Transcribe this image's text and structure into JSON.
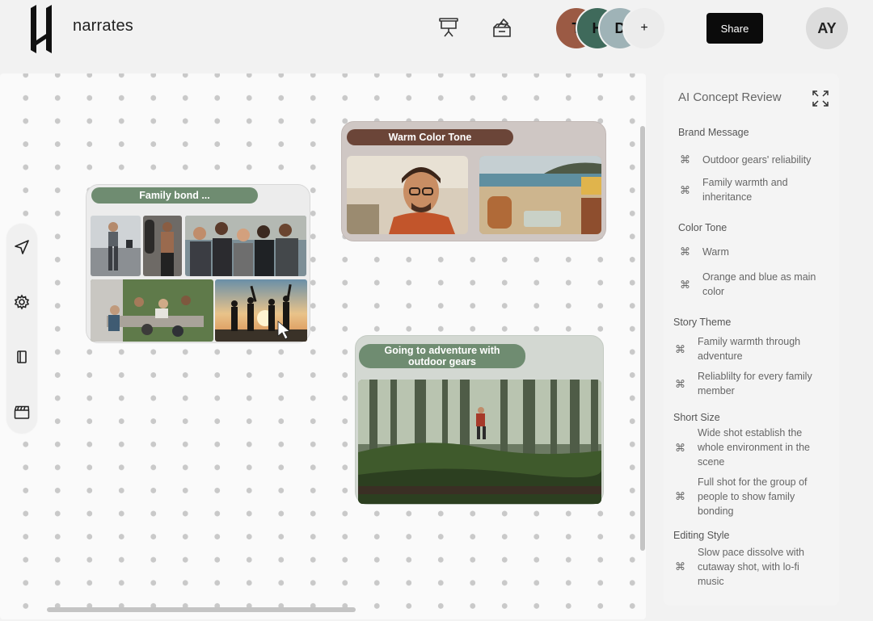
{
  "header": {
    "brand": "narrates",
    "collaborators": [
      "T",
      "H",
      "D"
    ],
    "add_collaborator": "+",
    "share_label": "Share",
    "user_initials": "AY"
  },
  "canvas": {
    "cards": [
      {
        "label": "Family bond ...",
        "label_color": "#6f8c71"
      },
      {
        "label": "Warm Color Tone",
        "label_color": "#6b4538"
      },
      {
        "label": "Going to adventure with outdoor gears",
        "label_color": "#6f8c71"
      }
    ],
    "toolbar": [
      "send-icon",
      "gear-icon",
      "book-icon",
      "clapperboard-icon"
    ]
  },
  "panel": {
    "title": "AI Concept Review",
    "cmd_glyph": "⌘",
    "sections": [
      {
        "title": "Brand Message",
        "items": [
          "Outdoor gears' reliability",
          "Family warmth and inheritance"
        ]
      },
      {
        "title": "Color Tone",
        "items": [
          "Warm",
          "Orange and blue as main color"
        ]
      },
      {
        "title": "Story Theme",
        "items": [
          "Family warmth through adventure",
          "Reliablilty for every family member"
        ]
      },
      {
        "title": "Short Size",
        "items": [
          "Wide shot establish the whole environment in the scene",
          "Full shot for the group of people to show family bonding"
        ]
      },
      {
        "title": "Editing Style",
        "items": [
          "Slow pace dissolve with cutaway shot, with lo-fi music"
        ]
      }
    ]
  },
  "colors": {
    "accent_green": "#6f8c71",
    "accent_brown": "#6b4538",
    "share_bg": "#0b0b0b"
  }
}
